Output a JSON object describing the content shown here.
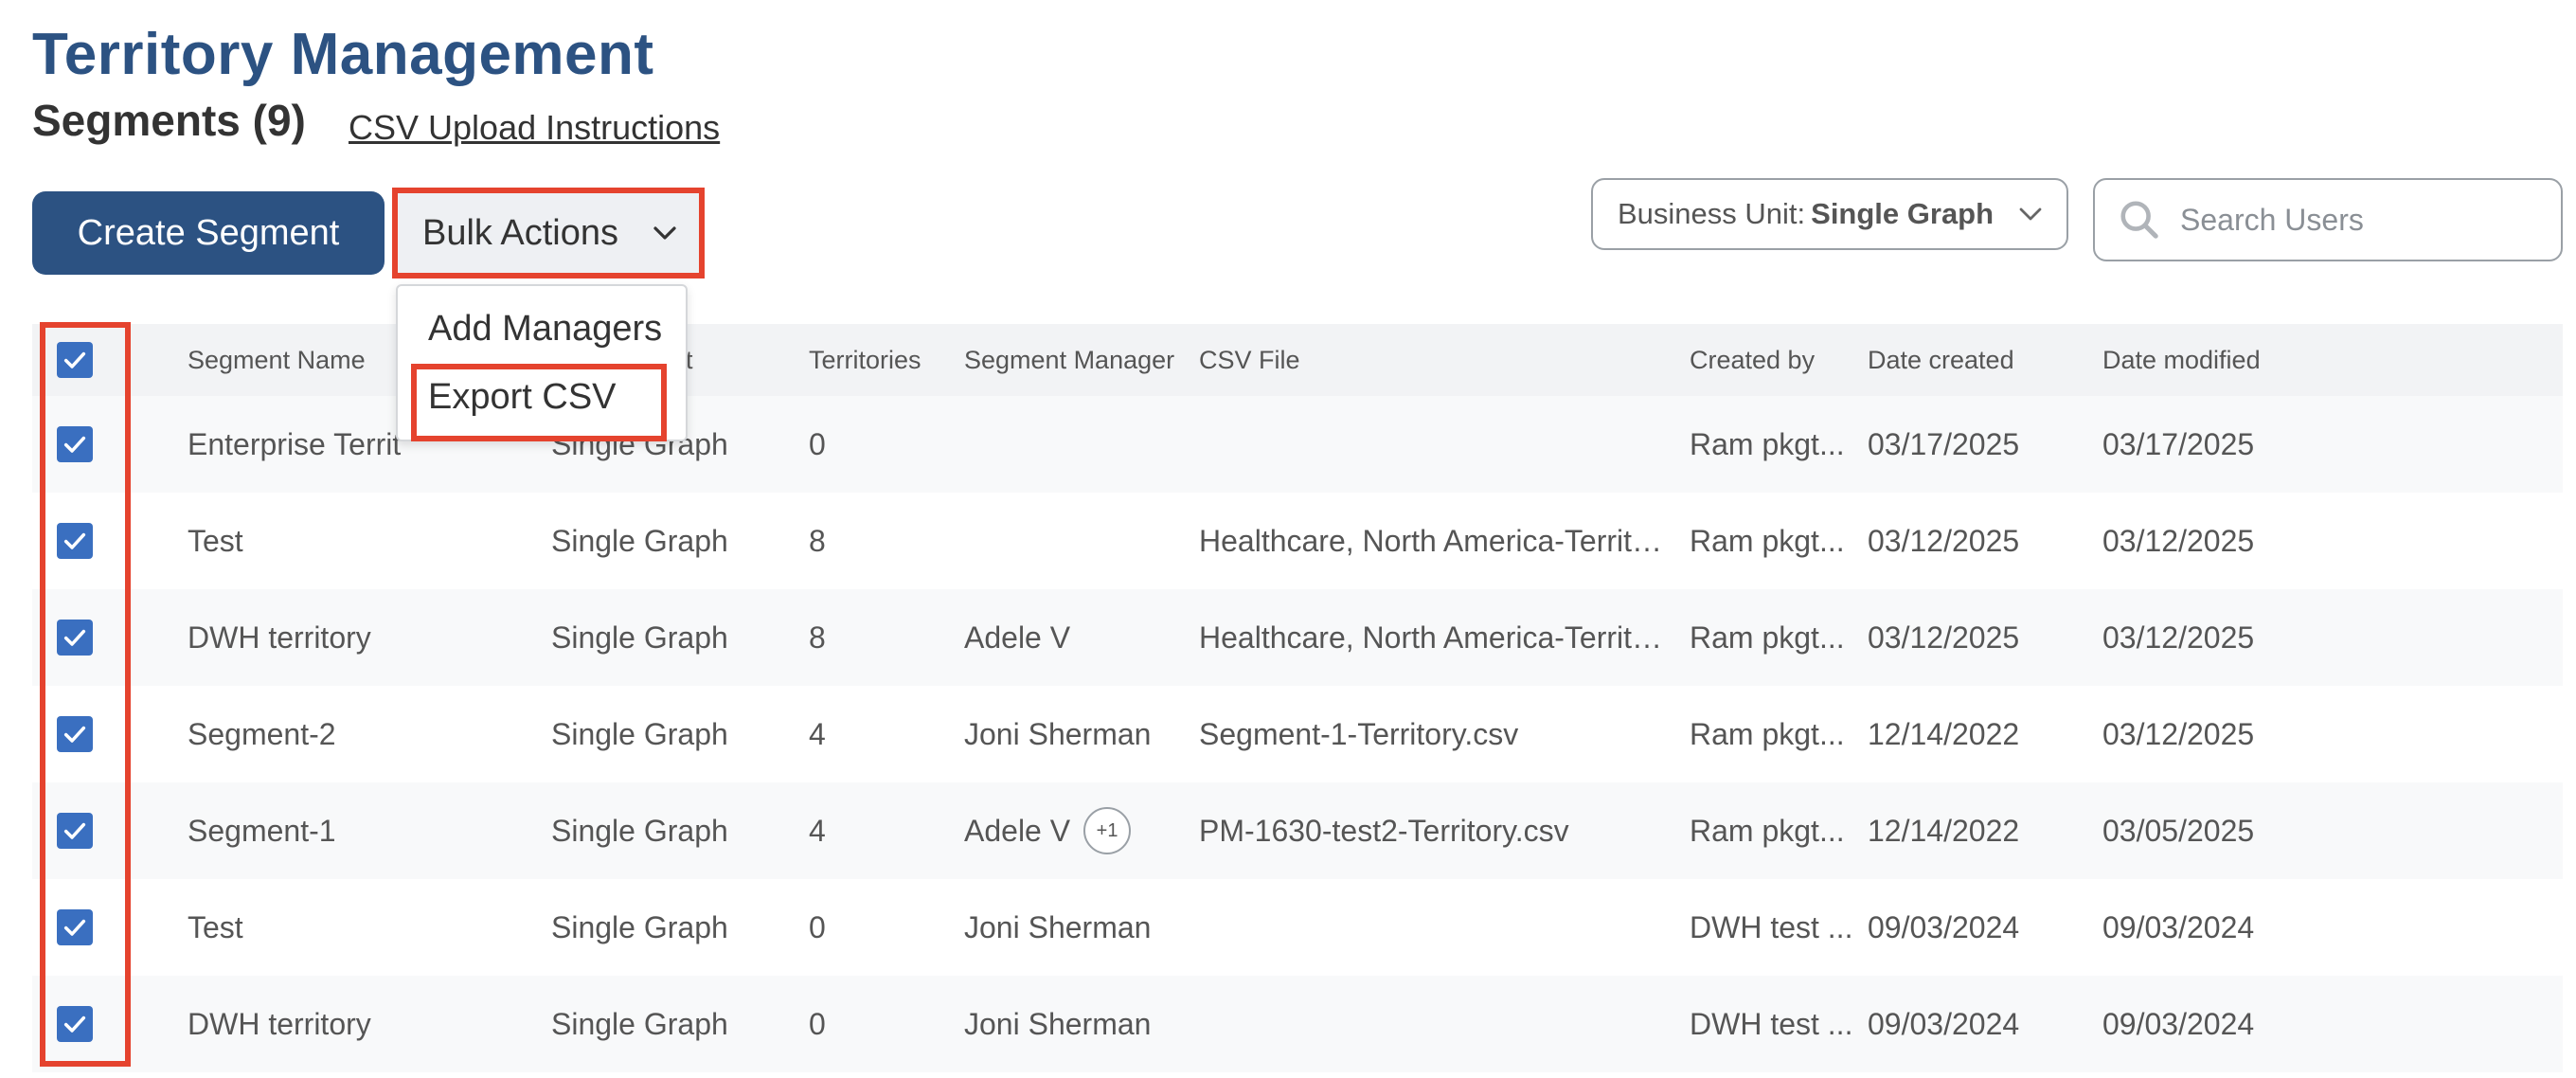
{
  "header": {
    "title": "Territory Management",
    "segments_heading": "Segments (9)",
    "csv_link": "CSV Upload Instructions"
  },
  "toolbar": {
    "create_label": "Create Segment",
    "bulk_label": "Bulk Actions",
    "business_unit_prefix": "Business Unit:",
    "business_unit_value": "Single Graph",
    "search_placeholder": "Search Users"
  },
  "bulk_menu": {
    "items": [
      "Add Managers",
      "Export CSV"
    ]
  },
  "table": {
    "columns": [
      "Segment Name",
      "it",
      "Territories",
      "Segment Manager",
      "CSV File",
      "Created by",
      "Date created",
      "Date modified"
    ],
    "rows": [
      {
        "name": "Enterprise Territ",
        "bu": "Single Graph",
        "territories": "0",
        "manager": "",
        "badge": "",
        "csv": "",
        "created_by": "Ram pkgt...",
        "date_created": "03/17/2025",
        "date_modified": "03/17/2025"
      },
      {
        "name": "Test",
        "bu": "Single Graph",
        "territories": "8",
        "manager": "",
        "badge": "",
        "csv": "Healthcare, North America-Territo...",
        "created_by": "Ram pkgt...",
        "date_created": "03/12/2025",
        "date_modified": "03/12/2025"
      },
      {
        "name": "DWH territory",
        "bu": "Single Graph",
        "territories": "8",
        "manager": "Adele V",
        "badge": "",
        "csv": "Healthcare, North America-Territo...",
        "created_by": "Ram pkgt...",
        "date_created": "03/12/2025",
        "date_modified": "03/12/2025"
      },
      {
        "name": "Segment-2",
        "bu": "Single Graph",
        "territories": "4",
        "manager": "Joni Sherman",
        "badge": "",
        "csv": "Segment-1-Territory.csv",
        "created_by": "Ram pkgt...",
        "date_created": "12/14/2022",
        "date_modified": "03/12/2025"
      },
      {
        "name": "Segment-1",
        "bu": "Single Graph",
        "territories": "4",
        "manager": "Adele V",
        "badge": "+1",
        "csv": "PM-1630-test2-Territory.csv",
        "created_by": "Ram pkgt...",
        "date_created": "12/14/2022",
        "date_modified": "03/05/2025"
      },
      {
        "name": "Test",
        "bu": "Single Graph",
        "territories": "0",
        "manager": "Joni Sherman",
        "badge": "",
        "csv": "",
        "created_by": "DWH test ...",
        "date_created": "09/03/2024",
        "date_modified": "09/03/2024"
      },
      {
        "name": "DWH territory",
        "bu": "Single Graph",
        "territories": "0",
        "manager": "Joni Sherman",
        "badge": "",
        "csv": "",
        "created_by": "DWH test ...",
        "date_created": "09/03/2024",
        "date_modified": "09/03/2024"
      }
    ]
  },
  "colors": {
    "brand": "#2c5282",
    "checkbox": "#3a6fc0",
    "highlight": "#e5432e"
  },
  "icons": {
    "bulk_chevron": "chevron-down-icon",
    "bu_chevron": "chevron-down-icon",
    "search": "search-icon",
    "checkbox": "checkbox-checked-icon"
  }
}
